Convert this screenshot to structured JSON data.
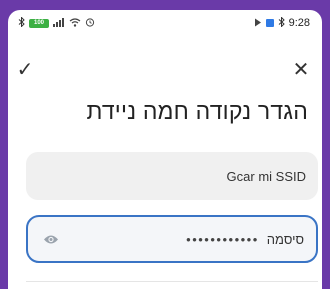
{
  "statusbar": {
    "battery": "100",
    "time": "9:28",
    "icons_left": [
      "bluetooth-icon",
      "battery-icon",
      "signal-icon",
      "wifi-icon",
      "alarm-icon"
    ],
    "icons_right": [
      "play-icon",
      "square-icon",
      "bluetooth-icon"
    ]
  },
  "toolbar": {
    "confirm_icon": "✓",
    "close_icon": "✕"
  },
  "page": {
    "title": "הגדר נקודה חמה ניידת"
  },
  "ssid": {
    "value": "Gcar mi  SSID"
  },
  "password": {
    "label": "סיסמה",
    "masked_value": "••••••••••••"
  },
  "colors": {
    "frame": "#6a3aa8",
    "field_border": "#3a74c5",
    "battery": "#3cb043"
  }
}
